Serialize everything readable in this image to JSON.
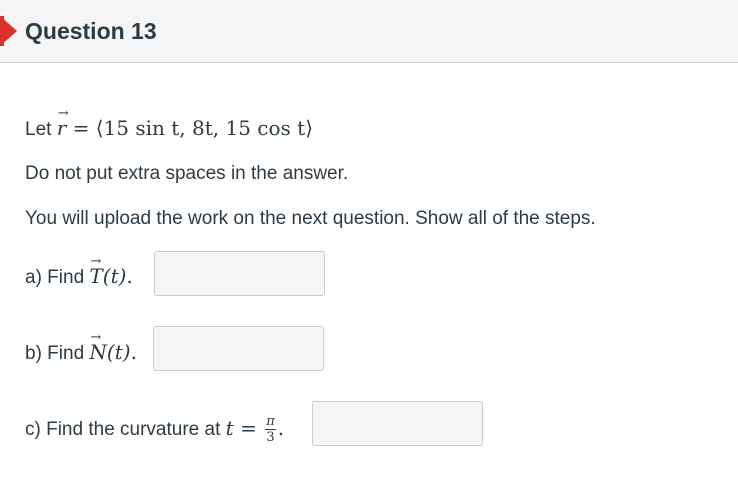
{
  "header": {
    "title": "Question 13",
    "flag_color": "#d9312b"
  },
  "question": {
    "let_label": "Let",
    "r_symbol": "r",
    "equals": "=",
    "r_expression": "⟨15 sin t, 8t, 15 cos t⟩",
    "instruction1": "Do not put extra spaces in the answer.",
    "instruction2": "You will upload the work on the next question. Show all of the steps."
  },
  "parts": [
    {
      "label": "a) Find",
      "symbol": "T",
      "arg": "(t)",
      "end": ".",
      "value": ""
    },
    {
      "label": "b) Find",
      "symbol": "N",
      "arg": "(t)",
      "end": ".",
      "value": ""
    },
    {
      "label": "c) Find the curvature at",
      "var": "t",
      "equals": "=",
      "frac_num": "π",
      "frac_den": "3",
      "end": ".",
      "value": ""
    }
  ]
}
